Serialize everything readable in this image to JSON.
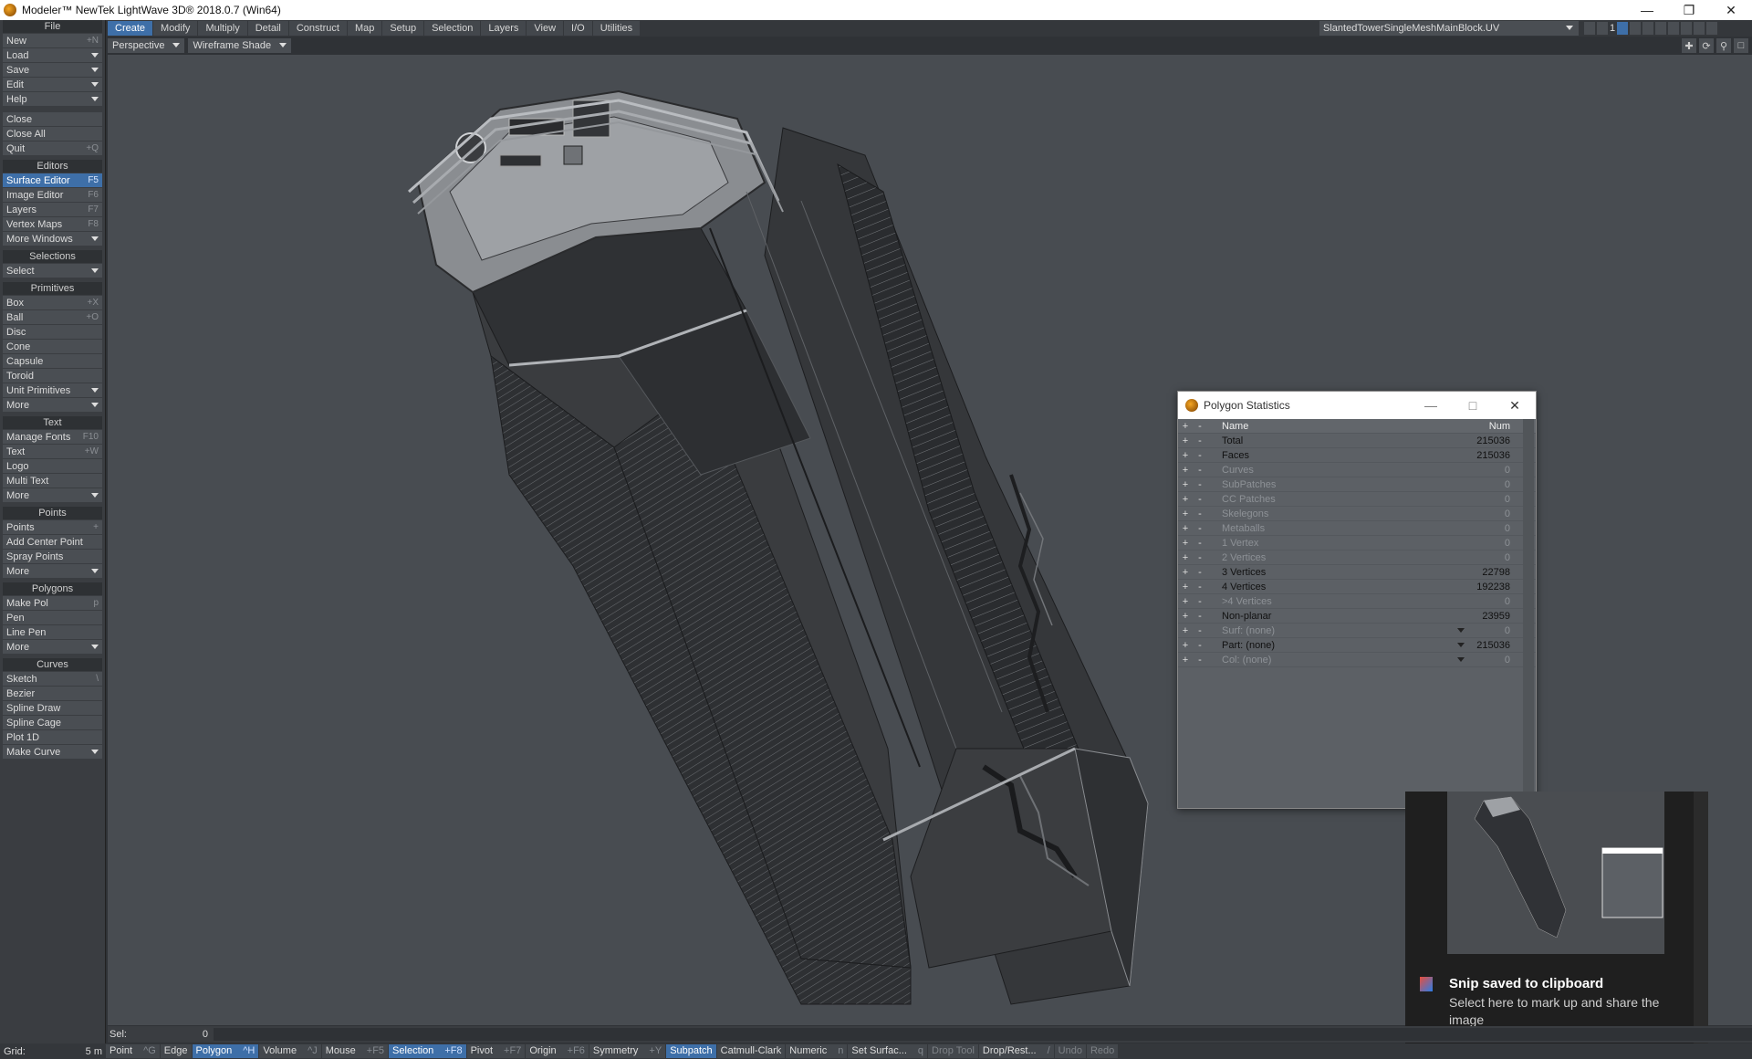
{
  "window": {
    "title": "Modeler™ NewTek LightWave 3D® 2018.0.7 (Win64)"
  },
  "sidebar": {
    "sections": [
      {
        "header": "File",
        "items": [
          {
            "label": "New",
            "shortcut": "+N"
          },
          {
            "label": "Load",
            "dropdown": true
          },
          {
            "label": "Save",
            "dropdown": true
          },
          {
            "label": "Edit",
            "dropdown": true
          },
          {
            "label": "Help",
            "dropdown": true
          },
          {
            "label": "Close",
            "gap": true
          },
          {
            "label": "Close All"
          },
          {
            "label": "Quit",
            "shortcut": "+Q"
          }
        ]
      },
      {
        "header": "Editors",
        "items": [
          {
            "label": "Surface Editor",
            "shortcut": "F5",
            "active": true
          },
          {
            "label": "Image Editor",
            "shortcut": "F6"
          },
          {
            "label": "Layers",
            "shortcut": "F7"
          },
          {
            "label": "Vertex Maps",
            "shortcut": "F8"
          },
          {
            "label": "More Windows",
            "dropdown": true
          }
        ]
      },
      {
        "header": "Selections",
        "items": [
          {
            "label": "Select",
            "dropdown": true
          }
        ]
      },
      {
        "header": "Primitives",
        "items": [
          {
            "label": "Box",
            "shortcut": "+X"
          },
          {
            "label": "Ball",
            "shortcut": "+O"
          },
          {
            "label": "Disc"
          },
          {
            "label": "Cone"
          },
          {
            "label": "Capsule"
          },
          {
            "label": "Toroid"
          },
          {
            "label": "Unit Primitives",
            "dropdown": true
          },
          {
            "label": "More",
            "dropdown": true
          }
        ]
      },
      {
        "header": "Text",
        "items": [
          {
            "label": "Manage Fonts",
            "shortcut": "F10"
          },
          {
            "label": "Text",
            "shortcut": "+W"
          },
          {
            "label": "Logo"
          },
          {
            "label": "Multi Text"
          },
          {
            "label": "More",
            "dropdown": true
          }
        ]
      },
      {
        "header": "Points",
        "items": [
          {
            "label": "Points",
            "shortcut": "+"
          },
          {
            "label": "Add Center Point"
          },
          {
            "label": "Spray Points"
          },
          {
            "label": "More",
            "dropdown": true
          }
        ]
      },
      {
        "header": "Polygons",
        "items": [
          {
            "label": "Make Pol",
            "shortcut": "p"
          },
          {
            "label": "Pen"
          },
          {
            "label": "Line Pen"
          },
          {
            "label": "More",
            "dropdown": true
          }
        ]
      },
      {
        "header": "Curves",
        "items": [
          {
            "label": "Sketch",
            "shortcut": "\\"
          },
          {
            "label": "Bezier"
          },
          {
            "label": "Spline Draw"
          },
          {
            "label": "Spline Cage"
          },
          {
            "label": "Plot 1D"
          },
          {
            "label": "Make Curve",
            "dropdown": true
          }
        ]
      }
    ]
  },
  "tabs": [
    "Create",
    "Modify",
    "Multiply",
    "Detail",
    "Construct",
    "Map",
    "Setup",
    "Selection",
    "Layers",
    "View",
    "I/O",
    "Utilities"
  ],
  "active_tab": "Create",
  "object_selector": {
    "value": "SlantedTowerSingleMeshMainBlock.UV"
  },
  "layer_strip": {
    "label": "1"
  },
  "viewport": {
    "view": "Perspective",
    "shading": "Wireframe Shade"
  },
  "polygon_stats": {
    "title": "Polygon Statistics",
    "col_name": "Name",
    "col_num": "Num",
    "rows": [
      {
        "name": "Total",
        "num": "215036",
        "dim": false
      },
      {
        "name": "Faces",
        "num": "215036",
        "dim": false
      },
      {
        "name": "Curves",
        "num": "0",
        "dim": true
      },
      {
        "name": "SubPatches",
        "num": "0",
        "dim": true
      },
      {
        "name": "CC Patches",
        "num": "0",
        "dim": true
      },
      {
        "name": "Skelegons",
        "num": "0",
        "dim": true
      },
      {
        "name": "Metaballs",
        "num": "0",
        "dim": true
      },
      {
        "name": "1 Vertex",
        "num": "0",
        "dim": true
      },
      {
        "name": "2 Vertices",
        "num": "0",
        "dim": true
      },
      {
        "name": "3 Vertices",
        "num": "22798",
        "dim": false
      },
      {
        "name": "4 Vertices",
        "num": "192238",
        "dim": false
      },
      {
        "name": ">4 Vertices",
        "num": "0",
        "dim": true
      },
      {
        "name": "Non-planar",
        "num": "23959",
        "dim": false
      },
      {
        "name": "Surf: (none)",
        "num": "0",
        "dim": true,
        "dropdown": true
      },
      {
        "name": "Part: (none)",
        "num": "215036",
        "dim": false,
        "dropdown": true
      },
      {
        "name": "Col: (none)",
        "num": "0",
        "dim": true,
        "dropdown": true
      }
    ]
  },
  "toast": {
    "title": "Snip saved to clipboard",
    "message": "Select here to mark up and share the image"
  },
  "selection": {
    "label": "Sel:",
    "value": "0"
  },
  "bottom": {
    "grid_label": "Grid:",
    "grid_value": "5 m",
    "modes": [
      {
        "label": "Point",
        "key": "^G"
      },
      {
        "label": "Edge",
        "key": ""
      },
      {
        "label": "Polygon",
        "key": "^H",
        "active": true
      },
      {
        "label": "Volume",
        "key": "^J"
      },
      {
        "label": "Mouse",
        "key": "+F5"
      },
      {
        "label": "Selection",
        "key": "+F8",
        "active": true
      },
      {
        "label": "Pivot",
        "key": "+F7"
      },
      {
        "label": "Origin",
        "key": "+F6"
      },
      {
        "label": "Symmetry",
        "key": "+Y"
      },
      {
        "label": "Subpatch",
        "key": "",
        "active": true
      },
      {
        "label": "Catmull-Clark",
        "key": ""
      },
      {
        "label": "Numeric",
        "key": "n"
      },
      {
        "label": "Set Surfac...",
        "key": "q"
      },
      {
        "label": "Drop Tool",
        "key": "",
        "dim": true
      },
      {
        "label": "Drop/Rest...",
        "key": "/"
      },
      {
        "label": "Undo",
        "key": "",
        "dim": true
      },
      {
        "label": "Redo",
        "key": "",
        "dim": true
      }
    ]
  }
}
